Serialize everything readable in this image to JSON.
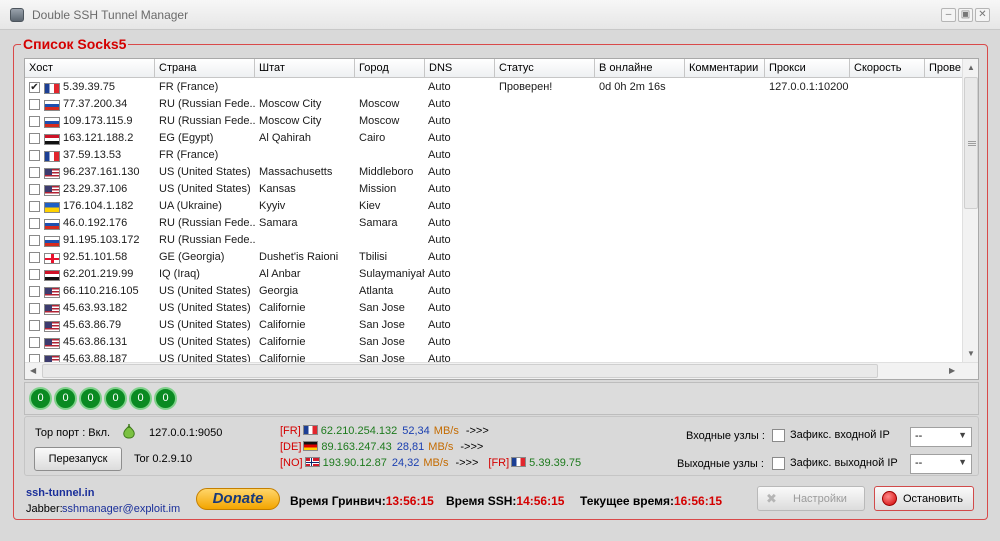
{
  "window": {
    "title": "Double SSH Tunnel Manager",
    "minimize": "–",
    "maximize": "▣",
    "close": "✕"
  },
  "socks": {
    "title": "Список Socks5",
    "columns": [
      "Хост",
      "Страна",
      "Штат",
      "Город",
      "DNS",
      "Статус",
      "В онлайне",
      "Комментарии",
      "Прокси",
      "Скорость",
      "Прове"
    ],
    "rows": [
      {
        "checked": true,
        "flag": "fr",
        "host": "5.39.39.75",
        "country": "FR (France)",
        "state": "",
        "city": "",
        "dns": "Auto",
        "status": "Проверен!",
        "online": "0d 0h 2m 16s",
        "comment": "",
        "proxy": "127.0.0.1:10200"
      },
      {
        "checked": false,
        "flag": "ru",
        "host": "77.37.200.34",
        "country": "RU (Russian Fede...",
        "state": "Moscow City",
        "city": "Moscow",
        "dns": "Auto",
        "status": "",
        "online": "",
        "comment": "",
        "proxy": ""
      },
      {
        "checked": false,
        "flag": "ru",
        "host": "109.173.115.9",
        "country": "RU (Russian Fede...",
        "state": "Moscow City",
        "city": "Moscow",
        "dns": "Auto",
        "status": "",
        "online": "",
        "comment": "",
        "proxy": ""
      },
      {
        "checked": false,
        "flag": "eg",
        "host": "163.121.188.2",
        "country": "EG (Egypt)",
        "state": "Al Qahirah",
        "city": "Cairo",
        "dns": "Auto",
        "status": "",
        "online": "",
        "comment": "",
        "proxy": ""
      },
      {
        "checked": false,
        "flag": "fr",
        "host": "37.59.13.53",
        "country": "FR (France)",
        "state": "",
        "city": "",
        "dns": "Auto",
        "status": "",
        "online": "",
        "comment": "",
        "proxy": ""
      },
      {
        "checked": false,
        "flag": "us",
        "host": "96.237.161.130",
        "country": "US (United States)",
        "state": "Massachusetts",
        "city": "Middleboro",
        "dns": "Auto",
        "status": "",
        "online": "",
        "comment": "",
        "proxy": ""
      },
      {
        "checked": false,
        "flag": "us",
        "host": "23.29.37.106",
        "country": "US (United States)",
        "state": "Kansas",
        "city": "Mission",
        "dns": "Auto",
        "status": "",
        "online": "",
        "comment": "",
        "proxy": ""
      },
      {
        "checked": false,
        "flag": "ua",
        "host": "176.104.1.182",
        "country": "UA (Ukraine)",
        "state": "Kyyiv",
        "city": "Kiev",
        "dns": "Auto",
        "status": "",
        "online": "",
        "comment": "",
        "proxy": ""
      },
      {
        "checked": false,
        "flag": "ru",
        "host": "46.0.192.176",
        "country": "RU (Russian Fede...",
        "state": "Samara",
        "city": "Samara",
        "dns": "Auto",
        "status": "",
        "online": "",
        "comment": "",
        "proxy": ""
      },
      {
        "checked": false,
        "flag": "ru",
        "host": "91.195.103.172",
        "country": "RU (Russian Fede...",
        "state": "",
        "city": "",
        "dns": "Auto",
        "status": "",
        "online": "",
        "comment": "",
        "proxy": ""
      },
      {
        "checked": false,
        "flag": "ge",
        "host": "92.51.101.58",
        "country": "GE (Georgia)",
        "state": "Dushet'is Raioni",
        "city": "Tbilisi",
        "dns": "Auto",
        "status": "",
        "online": "",
        "comment": "",
        "proxy": ""
      },
      {
        "checked": false,
        "flag": "iq",
        "host": "62.201.219.99",
        "country": "IQ (Iraq)",
        "state": "Al Anbar",
        "city": "Sulaymaniyah",
        "dns": "Auto",
        "status": "",
        "online": "",
        "comment": "",
        "proxy": ""
      },
      {
        "checked": false,
        "flag": "us",
        "host": "66.110.216.105",
        "country": "US (United States)",
        "state": "Georgia",
        "city": "Atlanta",
        "dns": "Auto",
        "status": "",
        "online": "",
        "comment": "",
        "proxy": ""
      },
      {
        "checked": false,
        "flag": "us",
        "host": "45.63.93.182",
        "country": "US (United States)",
        "state": "Californie",
        "city": "San Jose",
        "dns": "Auto",
        "status": "",
        "online": "",
        "comment": "",
        "proxy": ""
      },
      {
        "checked": false,
        "flag": "us",
        "host": "45.63.86.79",
        "country": "US (United States)",
        "state": "Californie",
        "city": "San Jose",
        "dns": "Auto",
        "status": "",
        "online": "",
        "comment": "",
        "proxy": ""
      },
      {
        "checked": false,
        "flag": "us",
        "host": "45.63.86.131",
        "country": "US (United States)",
        "state": "Californie",
        "city": "San Jose",
        "dns": "Auto",
        "status": "",
        "online": "",
        "comment": "",
        "proxy": ""
      },
      {
        "checked": false,
        "flag": "us",
        "host": "45.63.88.187",
        "country": "US (United States)",
        "state": "Californie",
        "city": "San Jose",
        "dns": "Auto",
        "status": "",
        "online": "",
        "comment": "",
        "proxy": ""
      }
    ]
  },
  "counters": [
    "0",
    "0",
    "0",
    "0",
    "0",
    "0"
  ],
  "tor": {
    "port_label": "Тор порт : Вкл.",
    "address": "127.0.0.1:9050",
    "restart": "Перезапуск",
    "version": "Tor 0.2.9.10"
  },
  "chain": [
    {
      "code": "[FR]",
      "flag": "fr",
      "ip": "62.210.254.132",
      "speed": "52,34",
      "unit": "MB/s",
      "arrow": "->>>"
    },
    {
      "code": "[DE]",
      "flag": "de",
      "ip": "89.163.247.43",
      "speed": "28,81",
      "unit": "MB/s",
      "arrow": "->>>"
    },
    {
      "code": "[NO]",
      "flag": "no",
      "ip": "193.90.12.87",
      "speed": "24,32",
      "unit": "MB/s",
      "arrow": "->>>",
      "dest_code": "[FR]",
      "dest_flag": "fr",
      "dest_ip": "5.39.39.75"
    }
  ],
  "nodes": {
    "in_label": "Входные узлы :",
    "in_fix": "Зафикс. входной IP",
    "in_value": "--",
    "out_label": "Выходные узлы :",
    "out_fix": "Зафикс. выходной IP",
    "out_value": "--"
  },
  "footer": {
    "site": "ssh-tunnel.in",
    "jabber_label": "Jabber:",
    "jabber": "sshmanager@exploit.im",
    "donate": "Donate",
    "gmt_label": "Время Гринвич:",
    "gmt": "13:56:15",
    "ssh_label": "Время SSH:",
    "ssh": "14:56:15",
    "now_label": "Текущее время:",
    "now": "16:56:15",
    "settings": "Настройки",
    "stop": "Остановить"
  },
  "colors": {
    "accent_red": "#d40000",
    "ok_green": "#0a8a22",
    "speed_blue": "#1a3fb0",
    "ip_green": "#1d7a1d",
    "unit_orange": "#c46b00"
  }
}
